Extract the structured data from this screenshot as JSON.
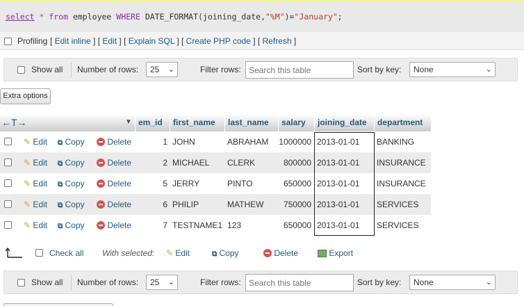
{
  "sql": {
    "parts": [
      {
        "t": "select",
        "c": "ku"
      },
      {
        "t": " * ",
        "c": "op"
      },
      {
        "t": "from",
        "c": "kw"
      },
      {
        "t": " employee ",
        "c": "nm"
      },
      {
        "t": "WHERE",
        "c": "kw"
      },
      {
        "t": " DATE_FORMAT(joining_date,",
        "c": "nm"
      },
      {
        "t": "\"%M\"",
        "c": "st"
      },
      {
        "t": ")=",
        "c": "nm"
      },
      {
        "t": "\"January\"",
        "c": "st"
      },
      {
        "t": ";",
        "c": "nm"
      }
    ]
  },
  "profiling": {
    "label": "Profiling",
    "links": [
      "Edit inline",
      "Edit",
      "Explain SQL",
      "Create PHP code",
      "Refresh"
    ]
  },
  "navbar": {
    "show_all": "Show all",
    "num_rows_label": "Number of rows:",
    "num_rows_value": "25",
    "filter_label": "Filter rows:",
    "filter_placeholder": "Search this table",
    "sort_label": "Sort by key:",
    "sort_value": "None"
  },
  "extra_options": "Extra options",
  "table": {
    "resize_glyph": "←T→",
    "columns": [
      "em_id",
      "first_name",
      "last_name",
      "salary",
      "joining_date",
      "department"
    ],
    "action_labels": {
      "edit": "Edit",
      "copy": "Copy",
      "delete": "Delete"
    },
    "rows": [
      {
        "em_id": "1",
        "first_name": "JOHN",
        "last_name": "ABRAHAM",
        "salary": "1000000",
        "joining_date": "2013-01-01",
        "department": "BANKING"
      },
      {
        "em_id": "2",
        "first_name": "MICHAEL",
        "last_name": "CLERK",
        "salary": "800000",
        "joining_date": "2013-01-01",
        "department": "INSURANCE"
      },
      {
        "em_id": "5",
        "first_name": "JERRY",
        "last_name": "PINTO",
        "salary": "650000",
        "joining_date": "2013-01-01",
        "department": "INSURANCE"
      },
      {
        "em_id": "6",
        "first_name": "PHILIP",
        "last_name": "MATHEW",
        "salary": "750000",
        "joining_date": "2013-01-01",
        "department": "SERVICES"
      },
      {
        "em_id": "7",
        "first_name": "TESTNAME1",
        "last_name": "123",
        "salary": "650000",
        "joining_date": "2013-01-01",
        "department": "SERVICES"
      }
    ]
  },
  "bulk": {
    "check_all": "Check all",
    "with_selected": "With selected:",
    "edit": "Edit",
    "copy": "Copy",
    "delete": "Delete",
    "export": "Export"
  },
  "colors": {
    "link": "#235a81",
    "row_alt": "#ebebeb",
    "header_text": "#235a81",
    "delete_icon": "#d9534f"
  }
}
